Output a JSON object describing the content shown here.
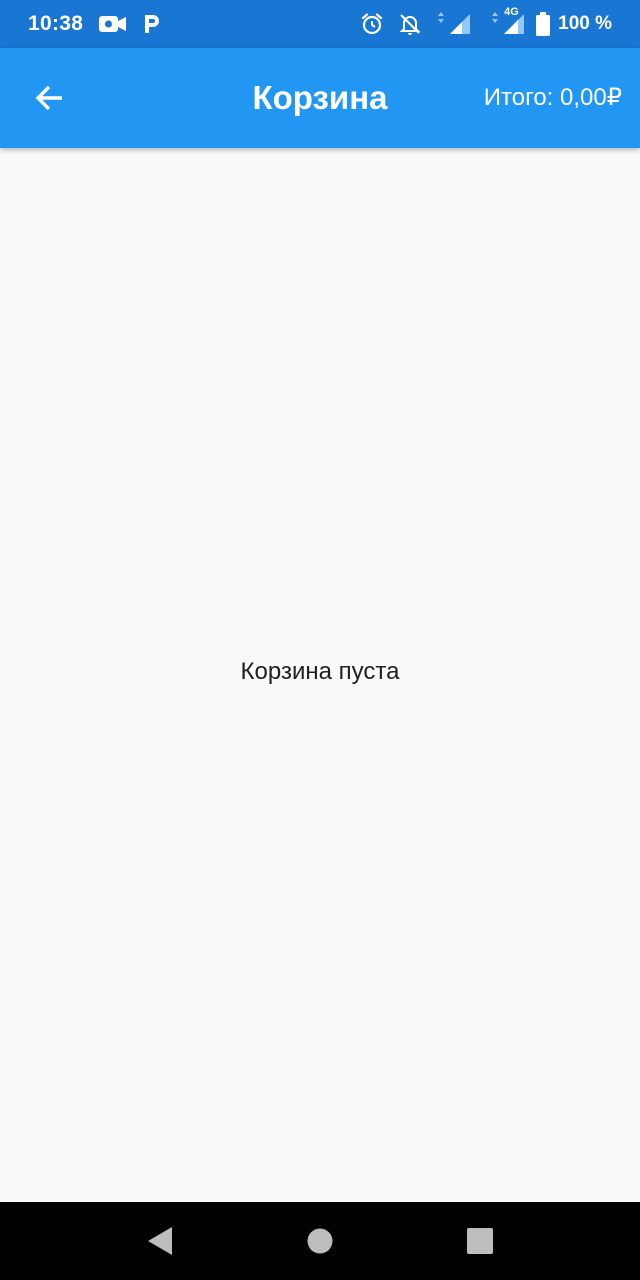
{
  "status_bar": {
    "time": "10:38",
    "left_icons": [
      "video-camera-icon",
      "p-notification-icon"
    ],
    "right_icons": [
      "alarm-icon",
      "notifications-off-icon",
      "signal-1-icon",
      "signal-2-4g-icon",
      "battery-icon"
    ],
    "network_label": "4G",
    "battery_percent": "100 %"
  },
  "app_bar": {
    "title": "Корзина",
    "total": "Итого: 0,00₽",
    "background": "#2196f3"
  },
  "content": {
    "empty_message": "Корзина пуста"
  },
  "nav_bar": {
    "buttons": [
      "back-triangle-icon",
      "home-circle-icon",
      "recents-square-icon"
    ]
  },
  "colors": {
    "status_bar": "#1976d2",
    "app_bar": "#2196f3",
    "background": "#fafafa",
    "nav_bar": "#000000"
  }
}
